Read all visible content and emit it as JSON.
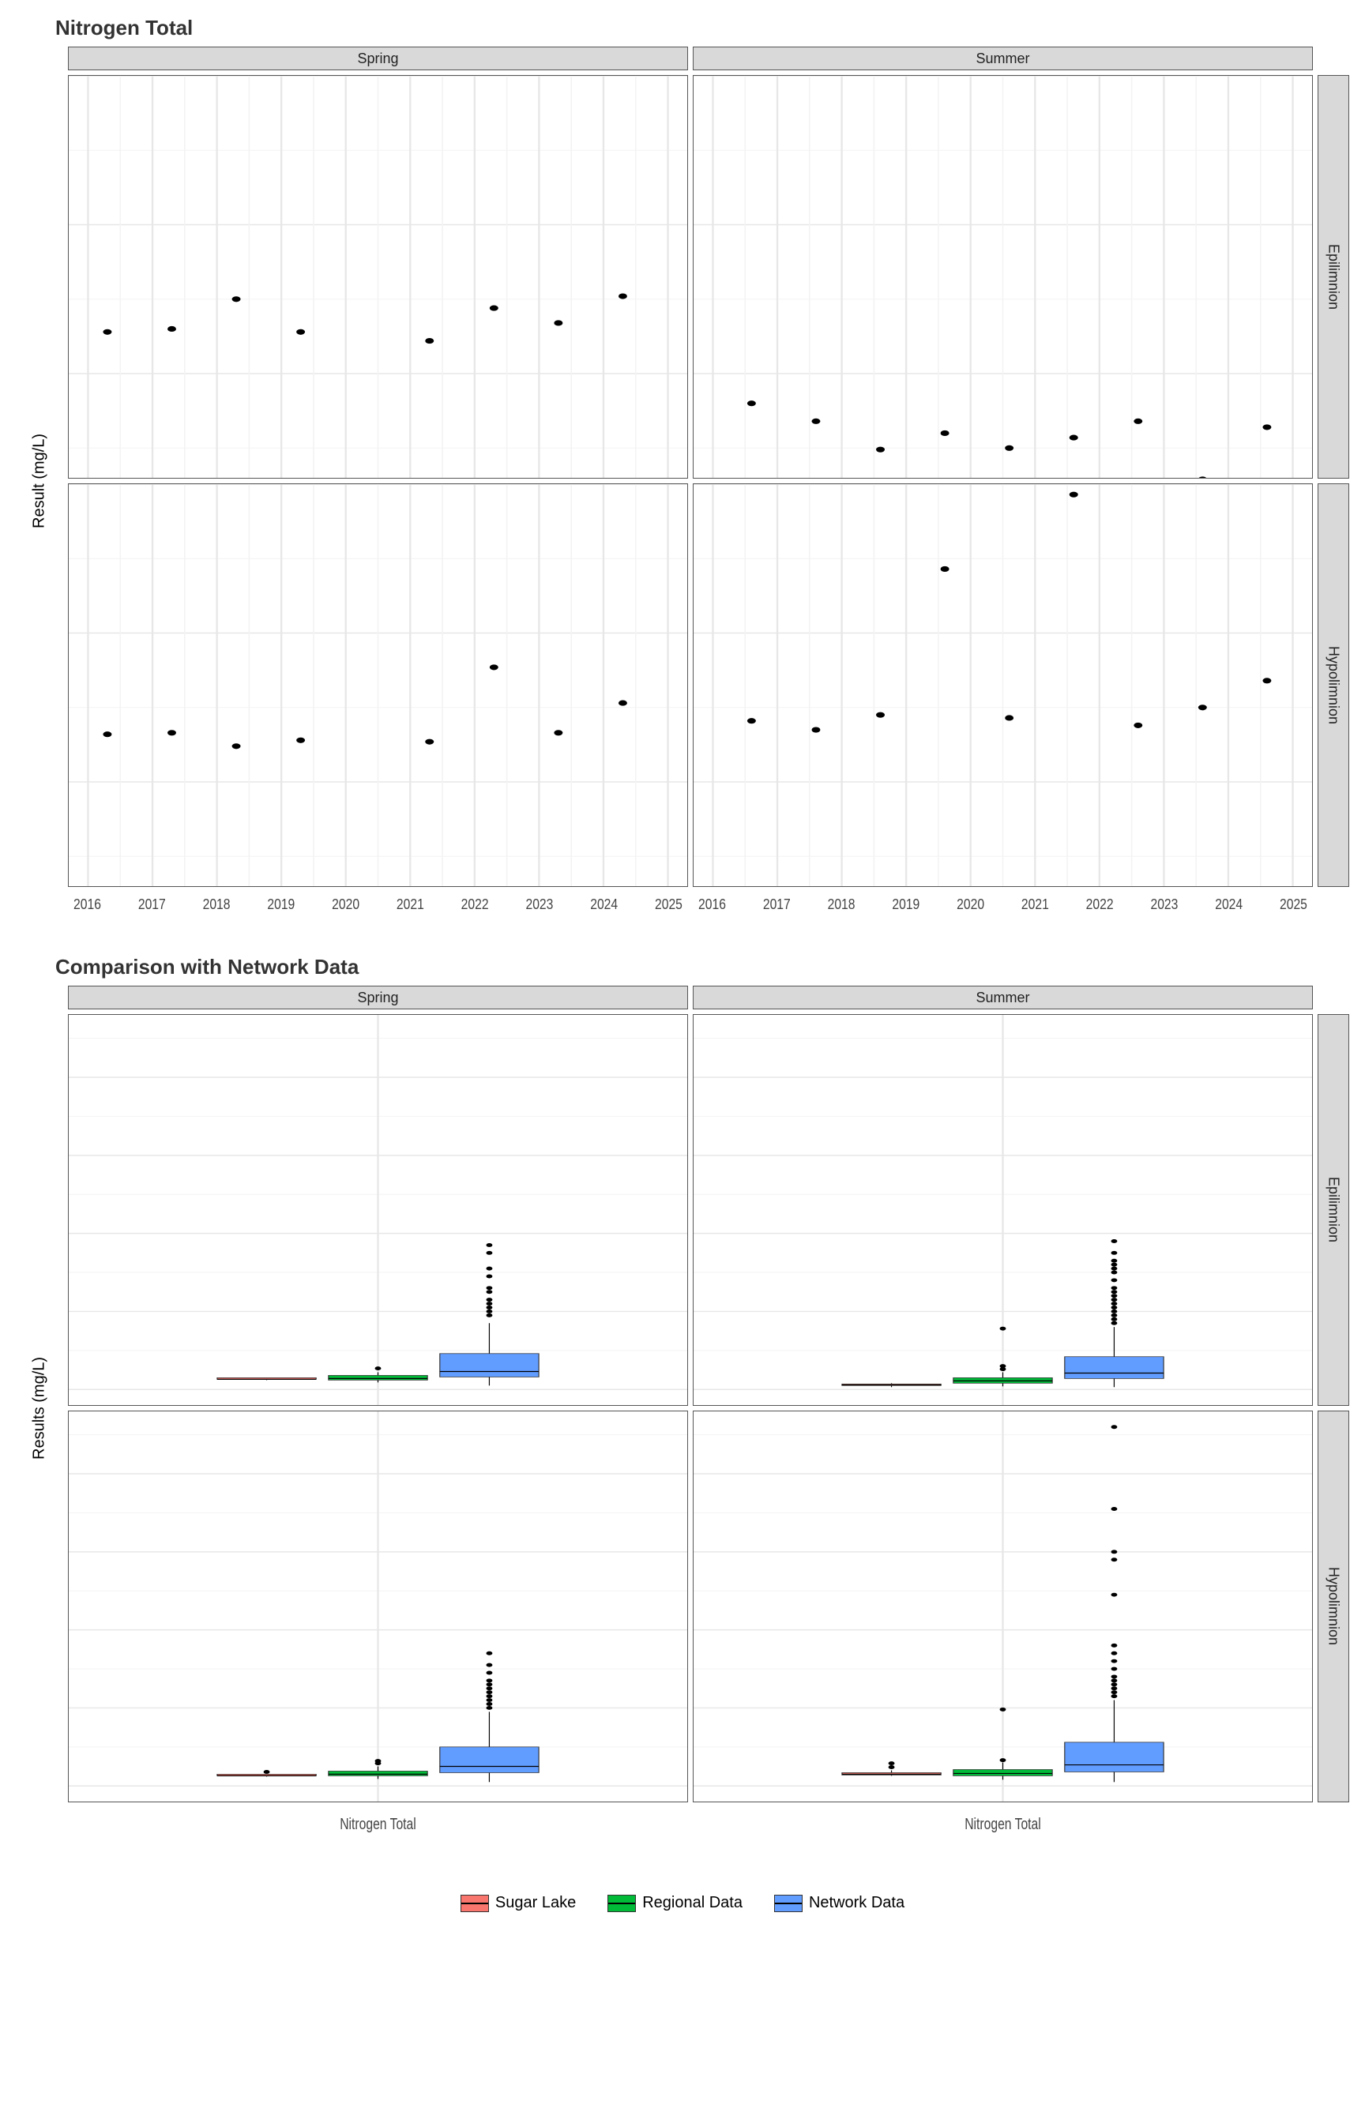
{
  "chart_data": [
    {
      "id": "scatter",
      "title": "Nitrogen Total",
      "ylabel": "Result (mg/L)",
      "type": "scatter",
      "x_years": [
        2016,
        2017,
        2018,
        2019,
        2020,
        2021,
        2022,
        2023,
        2024,
        2025
      ],
      "ylim": [
        0.03,
        0.3
      ],
      "yticks": [
        0.1,
        0.2,
        0.3
      ],
      "col_facets": [
        "Spring",
        "Summer"
      ],
      "row_facets": [
        "Epilimnion",
        "Hypolimnion"
      ],
      "panels": {
        "Spring|Epilimnion": [
          {
            "x": 2016.3,
            "y": 0.128
          },
          {
            "x": 2017.3,
            "y": 0.13
          },
          {
            "x": 2018.3,
            "y": 0.15
          },
          {
            "x": 2019.3,
            "y": 0.128
          },
          {
            "x": 2021.3,
            "y": 0.122
          },
          {
            "x": 2022.3,
            "y": 0.144
          },
          {
            "x": 2023.3,
            "y": 0.134
          },
          {
            "x": 2024.3,
            "y": 0.152
          }
        ],
        "Summer|Epilimnion": [
          {
            "x": 2016.6,
            "y": 0.08
          },
          {
            "x": 2017.6,
            "y": 0.068
          },
          {
            "x": 2018.6,
            "y": 0.049
          },
          {
            "x": 2019.6,
            "y": 0.06
          },
          {
            "x": 2020.6,
            "y": 0.05
          },
          {
            "x": 2021.6,
            "y": 0.057
          },
          {
            "x": 2022.6,
            "y": 0.068
          },
          {
            "x": 2023.6,
            "y": 0.029
          },
          {
            "x": 2024.6,
            "y": 0.064
          }
        ],
        "Spring|Hypolimnion": [
          {
            "x": 2016.3,
            "y": 0.132
          },
          {
            "x": 2017.3,
            "y": 0.133
          },
          {
            "x": 2018.3,
            "y": 0.124
          },
          {
            "x": 2019.3,
            "y": 0.128
          },
          {
            "x": 2021.3,
            "y": 0.127
          },
          {
            "x": 2022.3,
            "y": 0.177
          },
          {
            "x": 2023.3,
            "y": 0.133
          },
          {
            "x": 2024.3,
            "y": 0.153
          }
        ],
        "Summer|Hypolimnion": [
          {
            "x": 2016.6,
            "y": 0.141
          },
          {
            "x": 2017.6,
            "y": 0.135
          },
          {
            "x": 2018.6,
            "y": 0.145
          },
          {
            "x": 2019.6,
            "y": 0.243
          },
          {
            "x": 2020.6,
            "y": 0.143
          },
          {
            "x": 2021.6,
            "y": 0.293
          },
          {
            "x": 2022.6,
            "y": 0.138
          },
          {
            "x": 2023.6,
            "y": 0.15
          },
          {
            "x": 2024.6,
            "y": 0.168
          }
        ]
      }
    },
    {
      "id": "boxplot",
      "title": "Comparison with Network Data",
      "ylabel": "Results (mg/L)",
      "type": "boxplot",
      "xcat_label": "Nitrogen Total",
      "ylim": [
        -0.2,
        4.8
      ],
      "yticks": [
        0,
        1,
        2,
        3,
        4
      ],
      "col_facets": [
        "Spring",
        "Summer"
      ],
      "row_facets": [
        "Epilimnion",
        "Hypolimnion"
      ],
      "series_colors": {
        "Sugar Lake": "#F8766D",
        "Regional Data": "#00BA38",
        "Network Data": "#619CFF"
      },
      "series_order": [
        "Sugar Lake",
        "Regional Data",
        "Network Data"
      ],
      "panels": {
        "Spring|Epilimnion": {
          "Sugar Lake": {
            "min": 0.12,
            "q1": 0.13,
            "med": 0.13,
            "q3": 0.15,
            "max": 0.15,
            "out": []
          },
          "Regional Data": {
            "min": 0.09,
            "q1": 0.12,
            "med": 0.14,
            "q3": 0.18,
            "max": 0.22,
            "out": [
              0.27
            ]
          },
          "Network Data": {
            "min": 0.05,
            "q1": 0.16,
            "med": 0.23,
            "q3": 0.46,
            "max": 0.85,
            "out": [
              0.95,
              1.0,
              1.05,
              1.1,
              1.15,
              1.25,
              1.3,
              1.45,
              1.55,
              1.75,
              1.85
            ]
          }
        },
        "Summer|Epilimnion": {
          "Sugar Lake": {
            "min": 0.03,
            "q1": 0.05,
            "med": 0.06,
            "q3": 0.07,
            "max": 0.08,
            "out": []
          },
          "Regional Data": {
            "min": 0.04,
            "q1": 0.08,
            "med": 0.11,
            "q3": 0.15,
            "max": 0.22,
            "out": [
              0.26,
              0.3,
              0.78
            ]
          },
          "Network Data": {
            "min": 0.03,
            "q1": 0.14,
            "med": 0.21,
            "q3": 0.42,
            "max": 0.8,
            "out": [
              0.85,
              0.9,
              0.95,
              1.0,
              1.05,
              1.1,
              1.15,
              1.2,
              1.25,
              1.3,
              1.4,
              1.5,
              1.55,
              1.6,
              1.65,
              1.75,
              1.9
            ]
          }
        },
        "Spring|Hypolimnion": {
          "Sugar Lake": {
            "min": 0.12,
            "q1": 0.13,
            "med": 0.13,
            "q3": 0.15,
            "max": 0.15,
            "out": [
              0.18
            ]
          },
          "Regional Data": {
            "min": 0.09,
            "q1": 0.13,
            "med": 0.15,
            "q3": 0.19,
            "max": 0.25,
            "out": [
              0.29,
              0.32
            ]
          },
          "Network Data": {
            "min": 0.05,
            "q1": 0.17,
            "med": 0.25,
            "q3": 0.5,
            "max": 0.95,
            "out": [
              1.0,
              1.05,
              1.1,
              1.15,
              1.2,
              1.25,
              1.3,
              1.35,
              1.45,
              1.55,
              1.7
            ]
          }
        },
        "Summer|Hypolimnion": {
          "Sugar Lake": {
            "min": 0.13,
            "q1": 0.14,
            "med": 0.15,
            "q3": 0.17,
            "max": 0.2,
            "out": [
              0.24,
              0.29
            ]
          },
          "Regional Data": {
            "min": 0.08,
            "q1": 0.13,
            "med": 0.16,
            "q3": 0.21,
            "max": 0.3,
            "out": [
              0.33,
              0.98
            ]
          },
          "Network Data": {
            "min": 0.05,
            "q1": 0.18,
            "med": 0.27,
            "q3": 0.56,
            "max": 1.1,
            "out": [
              1.15,
              1.2,
              1.25,
              1.3,
              1.35,
              1.4,
              1.5,
              1.6,
              1.7,
              1.8,
              2.45,
              2.9,
              3.0,
              3.55,
              4.6
            ]
          }
        }
      }
    }
  ],
  "legend": {
    "items": [
      "Sugar Lake",
      "Regional Data",
      "Network Data"
    ]
  }
}
